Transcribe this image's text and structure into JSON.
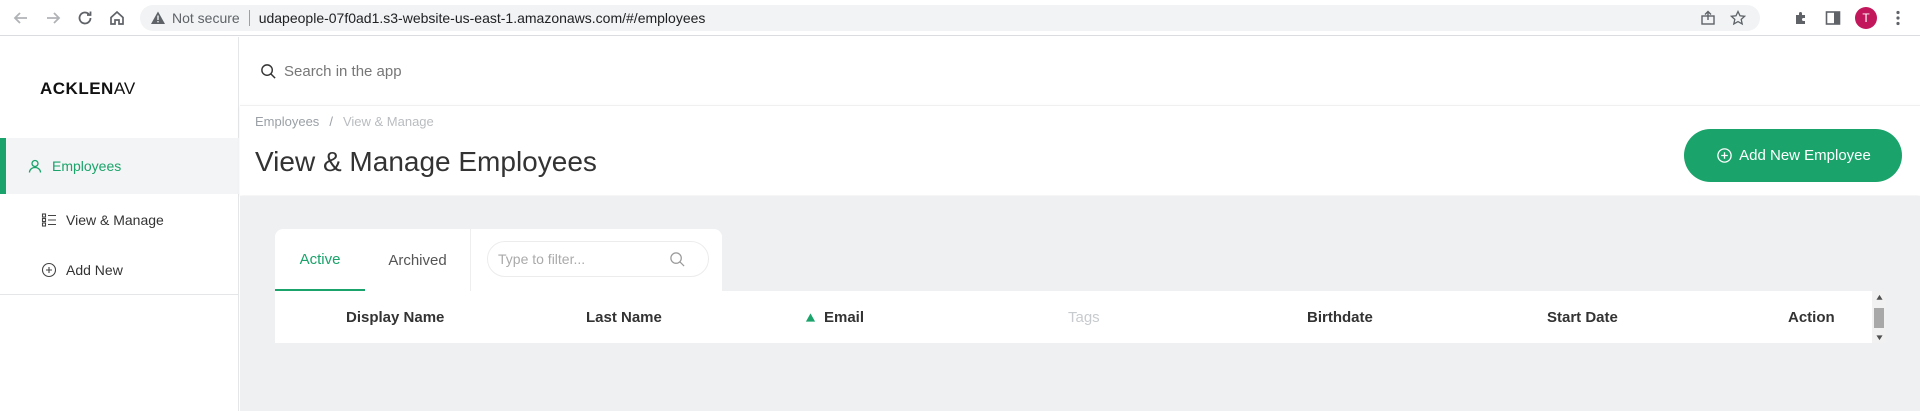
{
  "browser": {
    "security_label": "Not secure",
    "url": "udapeople-07f0ad1.s3-website-us-east-1.amazonaws.com/#/employees",
    "profile_initial": "T",
    "profile_color": "#c2185b"
  },
  "sidebar": {
    "logo_bold": "ACKLEN",
    "logo_thin": "AV",
    "items": [
      {
        "label": "Employees",
        "icon": "user-icon",
        "active": true
      },
      {
        "label": "View & Manage",
        "icon": "list-icon",
        "active": false
      },
      {
        "label": "Add New",
        "icon": "plus-circle-icon",
        "active": false
      }
    ]
  },
  "search": {
    "placeholder": "Search in the app"
  },
  "header": {
    "breadcrumb": [
      "Employees",
      "View & Manage"
    ],
    "breadcrumb_separator": "/",
    "title": "View & Manage Employees",
    "add_button_label": "Add New Employee"
  },
  "tabs": [
    {
      "label": "Active",
      "active": true
    },
    {
      "label": "Archived",
      "active": false
    }
  ],
  "filter": {
    "placeholder": "Type to filter..."
  },
  "table": {
    "columns": [
      {
        "label": "Display Name"
      },
      {
        "label": "Last Name"
      },
      {
        "label": "Email",
        "sorted": "asc"
      },
      {
        "label": "Tags",
        "disabled": true
      },
      {
        "label": "Birthdate"
      },
      {
        "label": "Start Date"
      },
      {
        "label": "Action"
      }
    ]
  },
  "colors": {
    "accent": "#1aa36a",
    "content_bg": "#eef0f2"
  }
}
